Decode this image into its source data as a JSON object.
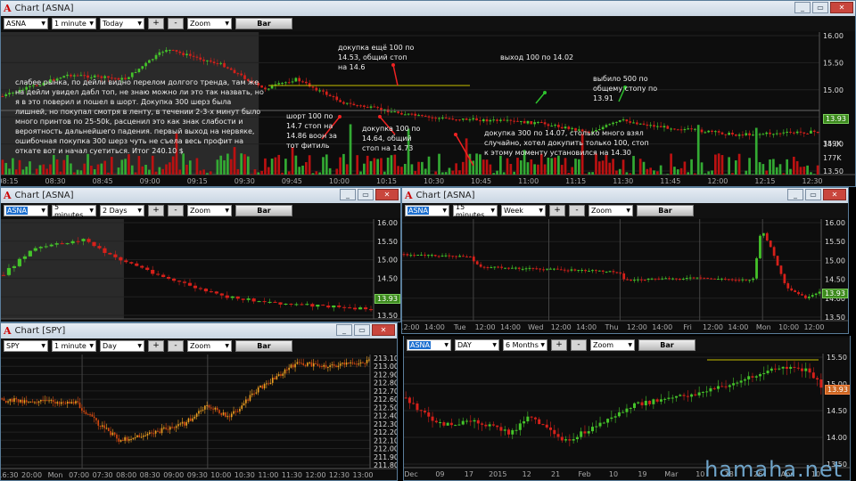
{
  "top": {
    "title": "Chart [ASNA]",
    "sym": "ASNA",
    "interval": "1 minute",
    "range": "Today",
    "zoom": "Zoom",
    "plus": "+",
    "minus": "-",
    "bar": "Bar",
    "y": [
      "16.00",
      "15.50",
      "15.00",
      "14.50",
      "14.00",
      "13.50"
    ],
    "last": "13.93",
    "vol": [
      "359K",
      "177K"
    ],
    "x": [
      "08:15",
      "08:30",
      "08:45",
      "09:00",
      "09:15",
      "09:30",
      "09:45",
      "10:00",
      "10:15",
      "10:30",
      "10:45",
      "11:00",
      "11:15",
      "11:30",
      "11:45",
      "12:00",
      "12:15",
      "12:30"
    ],
    "main_note": "слабее рынка, по дейли видно перелом долгого тренда, там же на дейли увидел дабл топ, не знаю можно ли это так назвать, но я в это поверил и пошел в шорт. Докупка 300 шерз была лишней, но покупал смотря в ленту, в течении 2-3-х минут было много принтов по 25-50k, расценил это как знак слабости и вероятность дальнейшего падения. первый выход на нервяке, ошибочная покупка 300 шерз чуть не съела весь профит на откате вот и начал суетиться. Итог 240.10 $",
    "ann": [
      "докупка ещё 100 по 14.53, общий стоп на 14.6",
      "выход 100 по 14.02",
      "выбило 500 по общему стопу по 13.91",
      "шорт 100 по 14.7 стоп на 14.86 воон за тот фитиль",
      "докупка 100 по 14.64, общий стоп на 14.73",
      "докупка 300 по 14.07,  столько много взял случайно, хотел докупить только 100, стоп к этому моменту установился на 14.30"
    ]
  },
  "w2": {
    "title": "Chart [ASNA]",
    "sym": "ASNA",
    "interval": "5 minutes",
    "range": "2 Days",
    "zoom": "Zoom",
    "bar": "Bar",
    "y": [
      "16.00",
      "15.50",
      "15.00",
      "14.50",
      "14.00",
      "13.50"
    ],
    "last": "13.93"
  },
  "w3": {
    "title": "Chart [ASNA]",
    "sym": "ASNA",
    "interval": "15 minutes",
    "range": "Week",
    "zoom": "Zoom",
    "bar": "Bar",
    "y": [
      "16.00",
      "15.50",
      "15.00",
      "14.50",
      "14.00",
      "13.50"
    ],
    "last": "13.93",
    "x": [
      "12:00",
      "14:00",
      "Tue",
      "12:00",
      "14:00",
      "Wed",
      "12:00",
      "14:00",
      "Thu",
      "12:00",
      "14:00",
      "Fri",
      "12:00",
      "14:00",
      "Mon",
      "10:00",
      "12:00"
    ]
  },
  "w4": {
    "title": "Chart [SPY]",
    "sym": "SPY",
    "interval": "1 minute",
    "range": "Day",
    "zoom": "Zoom",
    "bar": "Bar",
    "y": [
      "213.10",
      "213.00",
      "212.90",
      "212.80",
      "212.70",
      "212.60",
      "212.50",
      "212.40",
      "212.30",
      "212.20",
      "212.10",
      "212.00",
      "211.90",
      "211.80"
    ],
    "x": [
      "16:30",
      "20:00",
      "Mon",
      "07:00",
      "07:30",
      "08:00",
      "08:30",
      "09:00",
      "09:30",
      "10:00",
      "10:30",
      "11:00",
      "11:30",
      "12:00",
      "12:30",
      "13:00"
    ]
  },
  "w5": {
    "sym": "ASNA",
    "interval": "DAY",
    "range": "6 Months",
    "zoom": "Zoom",
    "bar": "Bar",
    "y": [
      "15.50",
      "15.00",
      "14.50",
      "14.00",
      "13.50"
    ],
    "last": "13.93",
    "x": [
      "Dec",
      "09",
      "17",
      "2015",
      "12",
      "21",
      "Feb",
      "10",
      "19",
      "Mar",
      "10",
      "18",
      "26",
      "Apr",
      "10"
    ]
  },
  "watermark": "hamaha.net"
}
